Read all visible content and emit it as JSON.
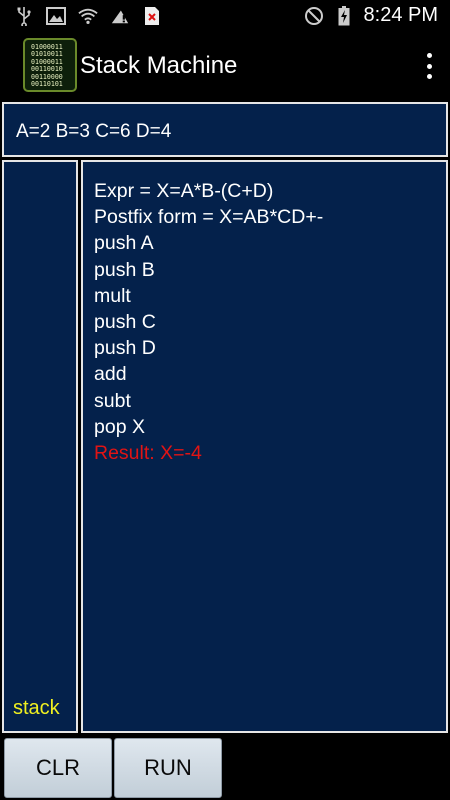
{
  "status_bar": {
    "time": "8:24 PM",
    "left_icons": [
      "usb-icon",
      "image-icon",
      "wifi-icon",
      "signal-alert-icon",
      "sim-error-icon"
    ],
    "right_icons": [
      "do-not-disturb-icon",
      "battery-charging-icon"
    ]
  },
  "app_bar": {
    "title": "Stack Machine",
    "logo_lines": [
      "01000011",
      "01010011",
      "01000011",
      "00110010",
      "00110000",
      "00110101"
    ]
  },
  "variables": "A=2 B=3 C=6 D=4",
  "stack": {
    "label": "stack"
  },
  "output": {
    "lines": [
      "Expr = X=A*B-(C+D)",
      "Postfix form = X=AB*CD+-",
      "push A",
      "push B",
      "mult",
      "push C",
      "push D",
      "add",
      "subt",
      "pop X"
    ],
    "result": "Result: X=-4",
    "result_color": "#e11414"
  },
  "buttons": {
    "clr": "CLR",
    "run": "RUN"
  },
  "colors": {
    "panel_bg": "#04214b",
    "stack_label": "#f0f020"
  }
}
